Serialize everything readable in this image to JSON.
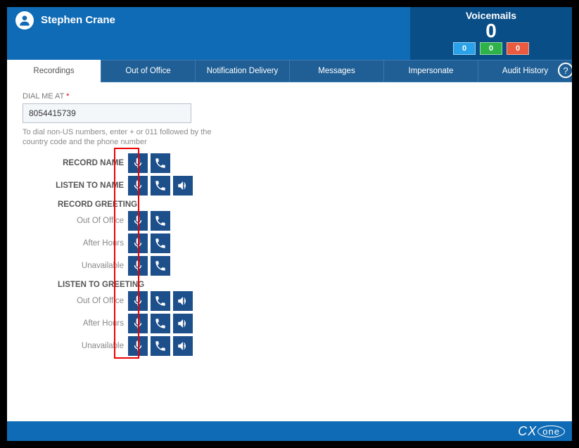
{
  "header": {
    "user_name": "Stephen Crane",
    "voicemails_title": "Voicemails",
    "voicemails_count": "0",
    "badge_blue": "0",
    "badge_green": "0",
    "badge_red": "0"
  },
  "tabs": {
    "recordings": "Recordings",
    "out_of_office": "Out of Office",
    "notification_delivery": "Notification Delivery",
    "messages": "Messages",
    "impersonate": "Impersonate",
    "audit_history": "Audit History",
    "help": "?"
  },
  "form": {
    "dial_me_label": "DIAL ME AT",
    "required_mark": "*",
    "dial_me_value": "8054415739",
    "hint": "To dial non-US numbers, enter + or 011 followed by the country code and the phone number",
    "record_name": "RECORD NAME",
    "listen_to_name": "LISTEN TO NAME",
    "record_greeting": "RECORD GREETING",
    "listen_to_greeting": "LISTEN TO GREETING",
    "out_of_office": "Out Of Office",
    "after_hours": "After Hours",
    "unavailable": "Unavailable"
  },
  "footer": {
    "logo_left": "CX",
    "logo_right": "one"
  }
}
